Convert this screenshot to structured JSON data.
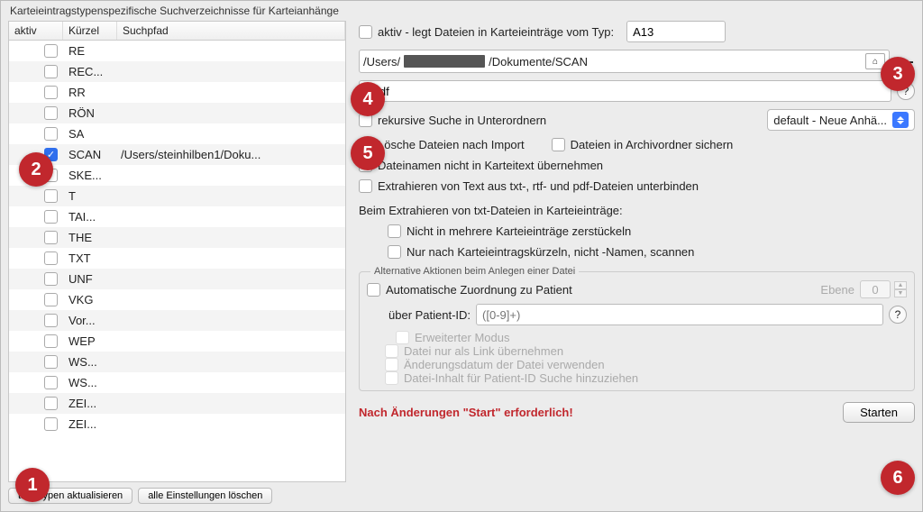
{
  "title": "Karteieintragstypenspezifische Suchverzeichnisse für Karteianhänge",
  "columns": {
    "aktiv": "aktiv",
    "kurz": "Kürzel",
    "path": "Suchpfad"
  },
  "rows": [
    {
      "checked": false,
      "kurz": "RE",
      "path": ""
    },
    {
      "checked": false,
      "kurz": "REC...",
      "path": ""
    },
    {
      "checked": false,
      "kurz": "RR",
      "path": ""
    },
    {
      "checked": false,
      "kurz": "RÖN",
      "path": ""
    },
    {
      "checked": false,
      "kurz": "SA",
      "path": ""
    },
    {
      "checked": true,
      "kurz": "SCAN",
      "path": "/Users/steinhilben1/Doku..."
    },
    {
      "checked": false,
      "kurz": "SKE...",
      "path": ""
    },
    {
      "checked": false,
      "kurz": "T",
      "path": ""
    },
    {
      "checked": false,
      "kurz": "TAI...",
      "path": ""
    },
    {
      "checked": false,
      "kurz": "THE",
      "path": ""
    },
    {
      "checked": false,
      "kurz": "TXT",
      "path": ""
    },
    {
      "checked": false,
      "kurz": "UNF",
      "path": ""
    },
    {
      "checked": false,
      "kurz": "VKG",
      "path": ""
    },
    {
      "checked": false,
      "kurz": "Vor...",
      "path": ""
    },
    {
      "checked": false,
      "kurz": "WEP",
      "path": ""
    },
    {
      "checked": false,
      "kurz": "WS...",
      "path": ""
    },
    {
      "checked": false,
      "kurz": "WS...",
      "path": ""
    },
    {
      "checked": false,
      "kurz": "ZEI...",
      "path": ""
    },
    {
      "checked": false,
      "kurz": "ZEI...",
      "path": ""
    }
  ],
  "leftButtons": {
    "refresh": "tragstypen aktualisieren",
    "clear": "alle Einstellungen löschen"
  },
  "right": {
    "aktivLabel": "aktiv - legt Dateien in Karteieinträge vom Typ:",
    "typValue": "A13",
    "pathPrefix": "/Users/",
    "pathSuffix": "/Dokumente/SCAN",
    "pattern": "*.pdf",
    "recursive": "rekursive Suche in Unterordnern",
    "selectValue": "default - Neue Anhä...",
    "deleteAfter": "Lösche Dateien nach Import",
    "archive": "Dateien in Archivordner sichern",
    "noFilename": "Dateinamen nicht in Karteitext übernehmen",
    "noExtract": "Extrahieren von Text aus txt-, rtf- und pdf-Dateien unterbinden",
    "extractHeader": "Beim Extrahieren von txt-Dateien in Karteieinträge:",
    "noSplit": "Nicht in mehrere Karteieinträge zerstückeln",
    "onlyKurz": "Nur nach Karteieintragskürzeln, nicht -Namen, scannen",
    "panelTitle": "Alternative Aktionen beim Anlegen einer Datei",
    "autoAssign": "Automatische Zuordnung zu Patient",
    "ebeneLabel": "Ebene",
    "ebeneValue": "0",
    "patientIdLabel": "über Patient-ID:",
    "patientIdPlaceholder": "([0-9]+)",
    "extMode": "Erweiterter Modus",
    "linkOnly": "Datei nur als Link übernehmen",
    "useDate": "Änderungsdatum der Datei verwenden",
    "useContent": "Datei-Inhalt für Patient-ID Suche hinzuziehen",
    "warning": "Nach Änderungen \"Start\" erforderlich!",
    "start": "Starten"
  },
  "badges": {
    "b1": "1",
    "b2": "2",
    "b3": "3",
    "b4": "4",
    "b5": "5",
    "b6": "6"
  }
}
